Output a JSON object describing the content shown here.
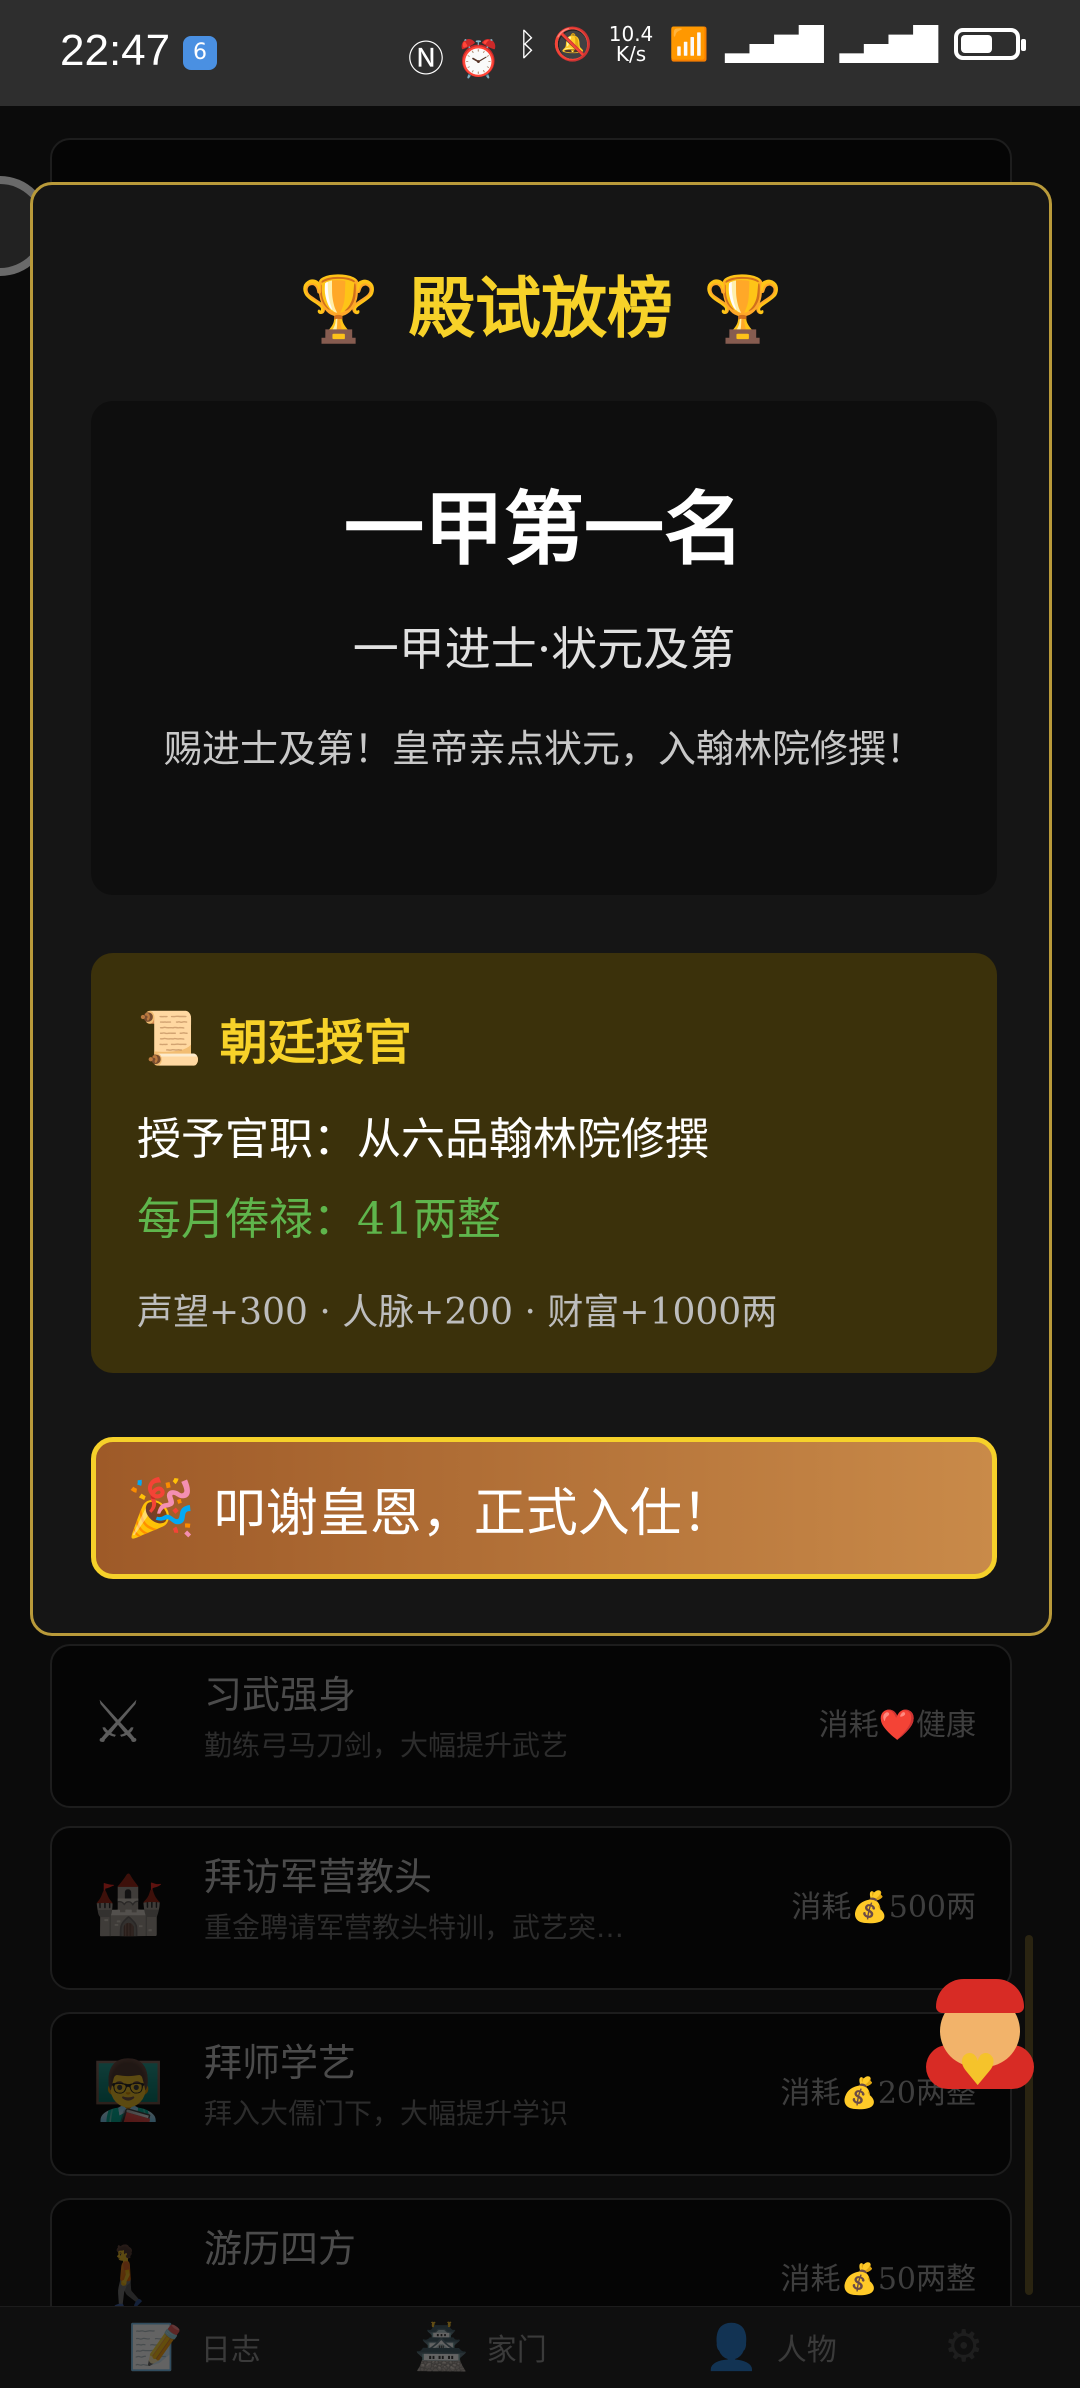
{
  "status_bar": {
    "time": "22:47",
    "app_badge": "6",
    "net_speed": "10.4\nK/s",
    "left_icons": [
      "nfc-icon",
      "alarm-icon"
    ],
    "right_icons": [
      "bluetooth-icon",
      "mute-icon",
      "wifi-icon",
      "signal-icon",
      "4g-signal-icon"
    ],
    "battery_level": 0.6
  },
  "modal": {
    "title": "殿试放榜",
    "rank": {
      "title": "一甲第一名",
      "subtitle": "一甲进士·状元及第",
      "description": "赐进士及第！皇帝亲点状元，入翰林院修撰！"
    },
    "office": {
      "title": "朝廷授官",
      "post_line": "授予官职：从六品翰林院修撰",
      "salary_line": "每月俸禄：41两整",
      "rewards_line": "声望+300 · 人脉+200 · 财富+1000两"
    },
    "confirm_label": "叩谢皇恩，正式入仕！"
  },
  "background_activities": [
    {
      "title": "习武强身",
      "desc": "勤练弓马刀剑，大幅提升武艺",
      "cost": "消耗❤️健康",
      "icon": "swords-icon"
    },
    {
      "title": "拜访军营教头",
      "desc": "重金聘请军营教头特训，武艺突…",
      "cost": "消耗💰500两",
      "icon": "castle-icon"
    },
    {
      "title": "拜师学艺",
      "desc": "拜入大儒门下，大幅提升学识",
      "cost": "消耗💰20两整",
      "icon": "scholar-icon"
    },
    {
      "title": "游历四方",
      "desc": "",
      "cost": "消耗💰50两整",
      "icon": "walker-icon"
    }
  ],
  "bottom_nav": [
    {
      "label": "日志",
      "icon": "journal-icon"
    },
    {
      "label": "家门",
      "icon": "home-icon"
    },
    {
      "label": "人物",
      "icon": "person-icon"
    },
    {
      "label": "",
      "icon": "settings-icon"
    }
  ]
}
